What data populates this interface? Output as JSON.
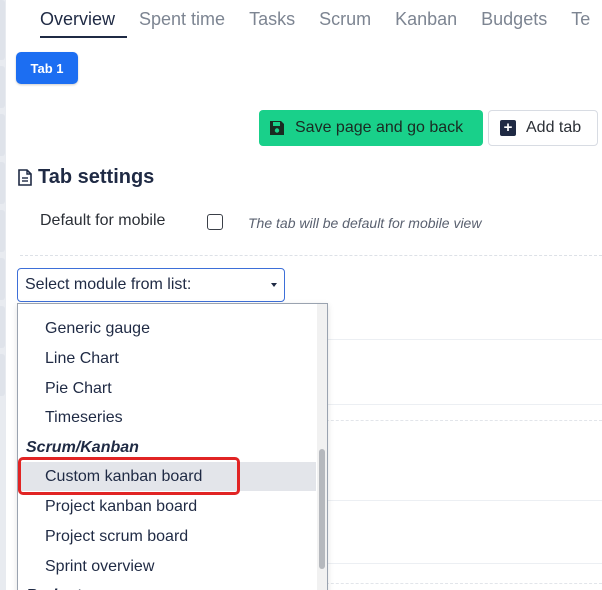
{
  "nav": {
    "tabs": [
      {
        "label": "Overview",
        "active": true
      },
      {
        "label": "Spent time",
        "active": false
      },
      {
        "label": "Tasks",
        "active": false
      },
      {
        "label": "Scrum",
        "active": false
      },
      {
        "label": "Kanban",
        "active": false
      },
      {
        "label": "Budgets",
        "active": false
      },
      {
        "label": "Te",
        "active": false
      }
    ]
  },
  "page_tabs": {
    "tab1_label": "Tab 1"
  },
  "toolbar": {
    "save_label": "Save page and go back",
    "add_tab_label": "Add tab",
    "save_icon": "save-icon",
    "add_icon": "plus-square-icon"
  },
  "settings": {
    "title": "Tab settings",
    "title_icon": "document-icon",
    "mobile_label": "Default for mobile",
    "mobile_checked": false,
    "mobile_hint": "The tab will be default for mobile view"
  },
  "module_select": {
    "value": "Select module from list:",
    "options": [
      {
        "kind": "item",
        "label": "Generic gauge"
      },
      {
        "kind": "item",
        "label": "Line Chart"
      },
      {
        "kind": "item",
        "label": "Pie Chart"
      },
      {
        "kind": "item",
        "label": "Timeseries"
      },
      {
        "kind": "group",
        "label": "Scrum/Kanban"
      },
      {
        "kind": "item",
        "label": "Custom kanban board",
        "hovered": true
      },
      {
        "kind": "item",
        "label": "Project kanban board"
      },
      {
        "kind": "item",
        "label": "Project scrum board"
      },
      {
        "kind": "item",
        "label": "Sprint overview"
      },
      {
        "kind": "group",
        "label": "Budgets"
      }
    ]
  },
  "colors": {
    "primary": "#1c6ef2",
    "save_green": "#19d08a",
    "highlight_red": "#e12424",
    "nav_active": "#1f2a44"
  }
}
